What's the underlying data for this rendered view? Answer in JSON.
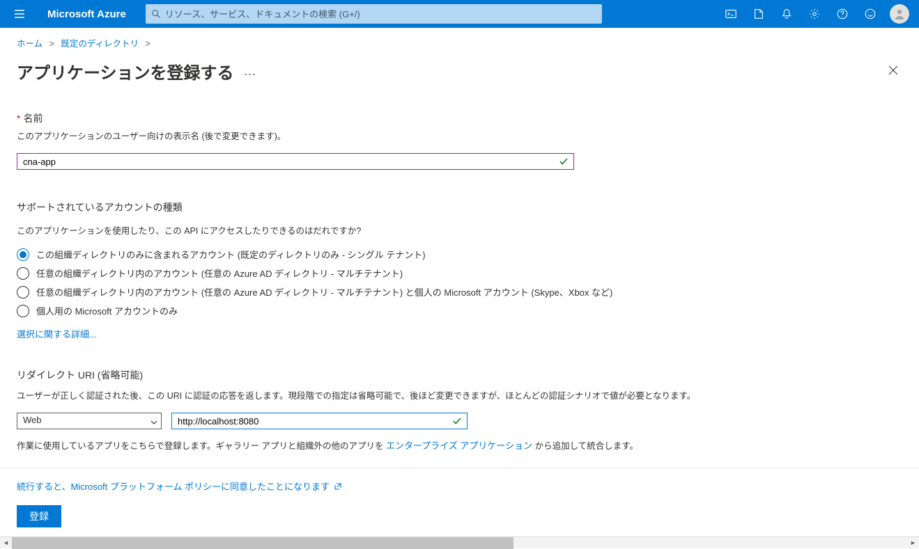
{
  "header": {
    "brand": "Microsoft Azure",
    "search_placeholder": "リソース、サービス、ドキュメントの検索 (G+/)"
  },
  "breadcrumb": {
    "home": "ホーム",
    "directory": "既定のディレクトリ"
  },
  "page": {
    "title": "アプリケーションを登録する"
  },
  "name_section": {
    "label": "名前",
    "help": "このアプリケーションのユーザー向けの表示名 (後で変更できます)。",
    "value": "cna-app"
  },
  "account_section": {
    "heading": "サポートされているアカウントの種類",
    "help": "このアプリケーションを使用したり、この API にアクセスしたりできるのはだれですか?",
    "options": [
      "この組織ディレクトリのみに含まれるアカウント (既定のディレクトリのみ - シングル テナント)",
      "任意の組織ディレクトリ内のアカウント (任意の Azure AD ディレクトリ - マルチテナント)",
      "任意の組織ディレクトリ内のアカウント (任意の Azure AD ディレクトリ - マルチテナント) と個人の Microsoft アカウント (Skype、Xbox など)",
      "個人用の Microsoft アカウントのみ"
    ],
    "selected_index": 0,
    "details_link": "選択に関する詳細..."
  },
  "redirect_section": {
    "heading": "リダイレクト URI (省略可能)",
    "help": "ユーザーが正しく認証された後、この URI に認証の応答を返します。現段階での指定は省略可能で、後ほど変更できますが、ほとんどの認証シナリオで値が必要となります。",
    "platform_value": "Web",
    "uri_value": "http://localhost:8080",
    "note_prefix": "作業に使用しているアプリをこちらで登録します。ギャラリー アプリと組織外の他のアプリを ",
    "note_link": "エンタープライズ アプリケーション",
    "note_suffix": " から追加して統合します。"
  },
  "footer": {
    "policy_text": "続行すると、Microsoft プラットフォーム ポリシーに同意したことになります",
    "register_label": "登録"
  }
}
